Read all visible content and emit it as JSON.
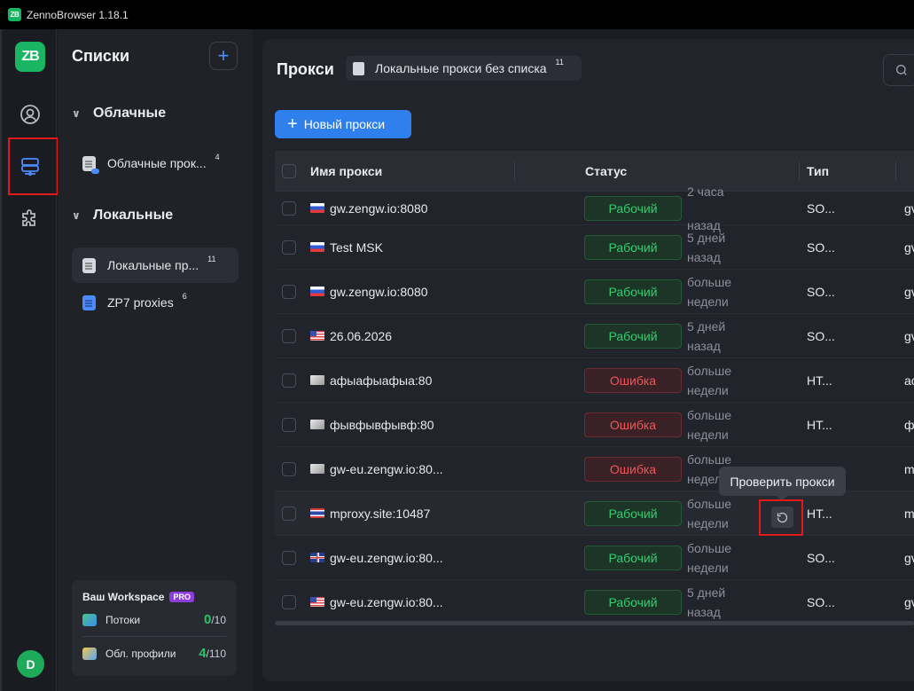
{
  "app": {
    "logo_text": "ZB",
    "window_title": "ZennoBrowser 1.18.1"
  },
  "rail": {
    "avatar_letter": "D"
  },
  "lists": {
    "title": "Списки",
    "add_label": "+",
    "cloud_section": "Облачные",
    "cloud_items": [
      {
        "label": "Облачные прок...",
        "count": "4"
      }
    ],
    "local_section": "Локальные",
    "local_items": [
      {
        "label": "Локальные пр...",
        "count": "11"
      },
      {
        "label": "ZP7 proxies",
        "count": "6"
      }
    ]
  },
  "workspace": {
    "title": "Ваш Workspace",
    "badge": "PRO",
    "threads_label": "Потоки",
    "threads_used": "0",
    "threads_total": "/10",
    "profiles_label": "Обл. профили",
    "profiles_used": "4",
    "profiles_total": "/110"
  },
  "main": {
    "title": "Прокси",
    "chip_label": "Локальные прокси без списка",
    "chip_count": "11",
    "new_button": "Новый прокси",
    "columns": {
      "name": "Имя прокси",
      "status": "Статус",
      "type": "Тип"
    },
    "tooltip": "Проверить прокси",
    "rows": [
      {
        "flag": "ru",
        "name": "gw.zengw.io:8080",
        "status": "Рабочий",
        "ok": true,
        "when1": "2 часа назад",
        "when2": "",
        "type": "SO...",
        "extra": "gv"
      },
      {
        "flag": "ru",
        "name": "Test MSK",
        "status": "Рабочий",
        "ok": true,
        "when1": "5 дней",
        "when2": "назад",
        "type": "SO...",
        "extra": "gv"
      },
      {
        "flag": "ru",
        "name": "gw.zengw.io:8080",
        "status": "Рабочий",
        "ok": true,
        "when1": "больше",
        "when2": "недели",
        "type": "SO...",
        "extra": "gv"
      },
      {
        "flag": "us",
        "name": "26.06.2026",
        "status": "Рабочий",
        "ok": true,
        "when1": "5 дней",
        "when2": "назад",
        "type": "SO...",
        "extra": "gv"
      },
      {
        "flag": "none",
        "name": "афыафыафыа:80",
        "status": "Ошибка",
        "ok": false,
        "when1": "больше",
        "when2": "недели",
        "type": "HT...",
        "extra": "ac"
      },
      {
        "flag": "none",
        "name": "фывфывфывф:80",
        "status": "Ошибка",
        "ok": false,
        "when1": "больше",
        "when2": "недели",
        "type": "HT...",
        "extra": "фі"
      },
      {
        "flag": "none",
        "name": "gw-eu.zengw.io:80...",
        "status": "Ошибка",
        "ok": false,
        "when1": "больше",
        "when2": "неделі",
        "type": "",
        "extra": "m"
      },
      {
        "flag": "th",
        "name": "mproxy.site:10487",
        "status": "Рабочий",
        "ok": true,
        "when1": "больше",
        "when2": "недели",
        "type": "HT...",
        "extra": "m"
      },
      {
        "flag": "gb",
        "name": "gw-eu.zengw.io:80...",
        "status": "Рабочий",
        "ok": true,
        "when1": "больше",
        "when2": "недели",
        "type": "SO...",
        "extra": "gv"
      },
      {
        "flag": "us",
        "name": "gw-eu.zengw.io:80...",
        "status": "Рабочий",
        "ok": true,
        "when1": "5 дней",
        "when2": "назад",
        "type": "SO...",
        "extra": "gv"
      }
    ]
  }
}
